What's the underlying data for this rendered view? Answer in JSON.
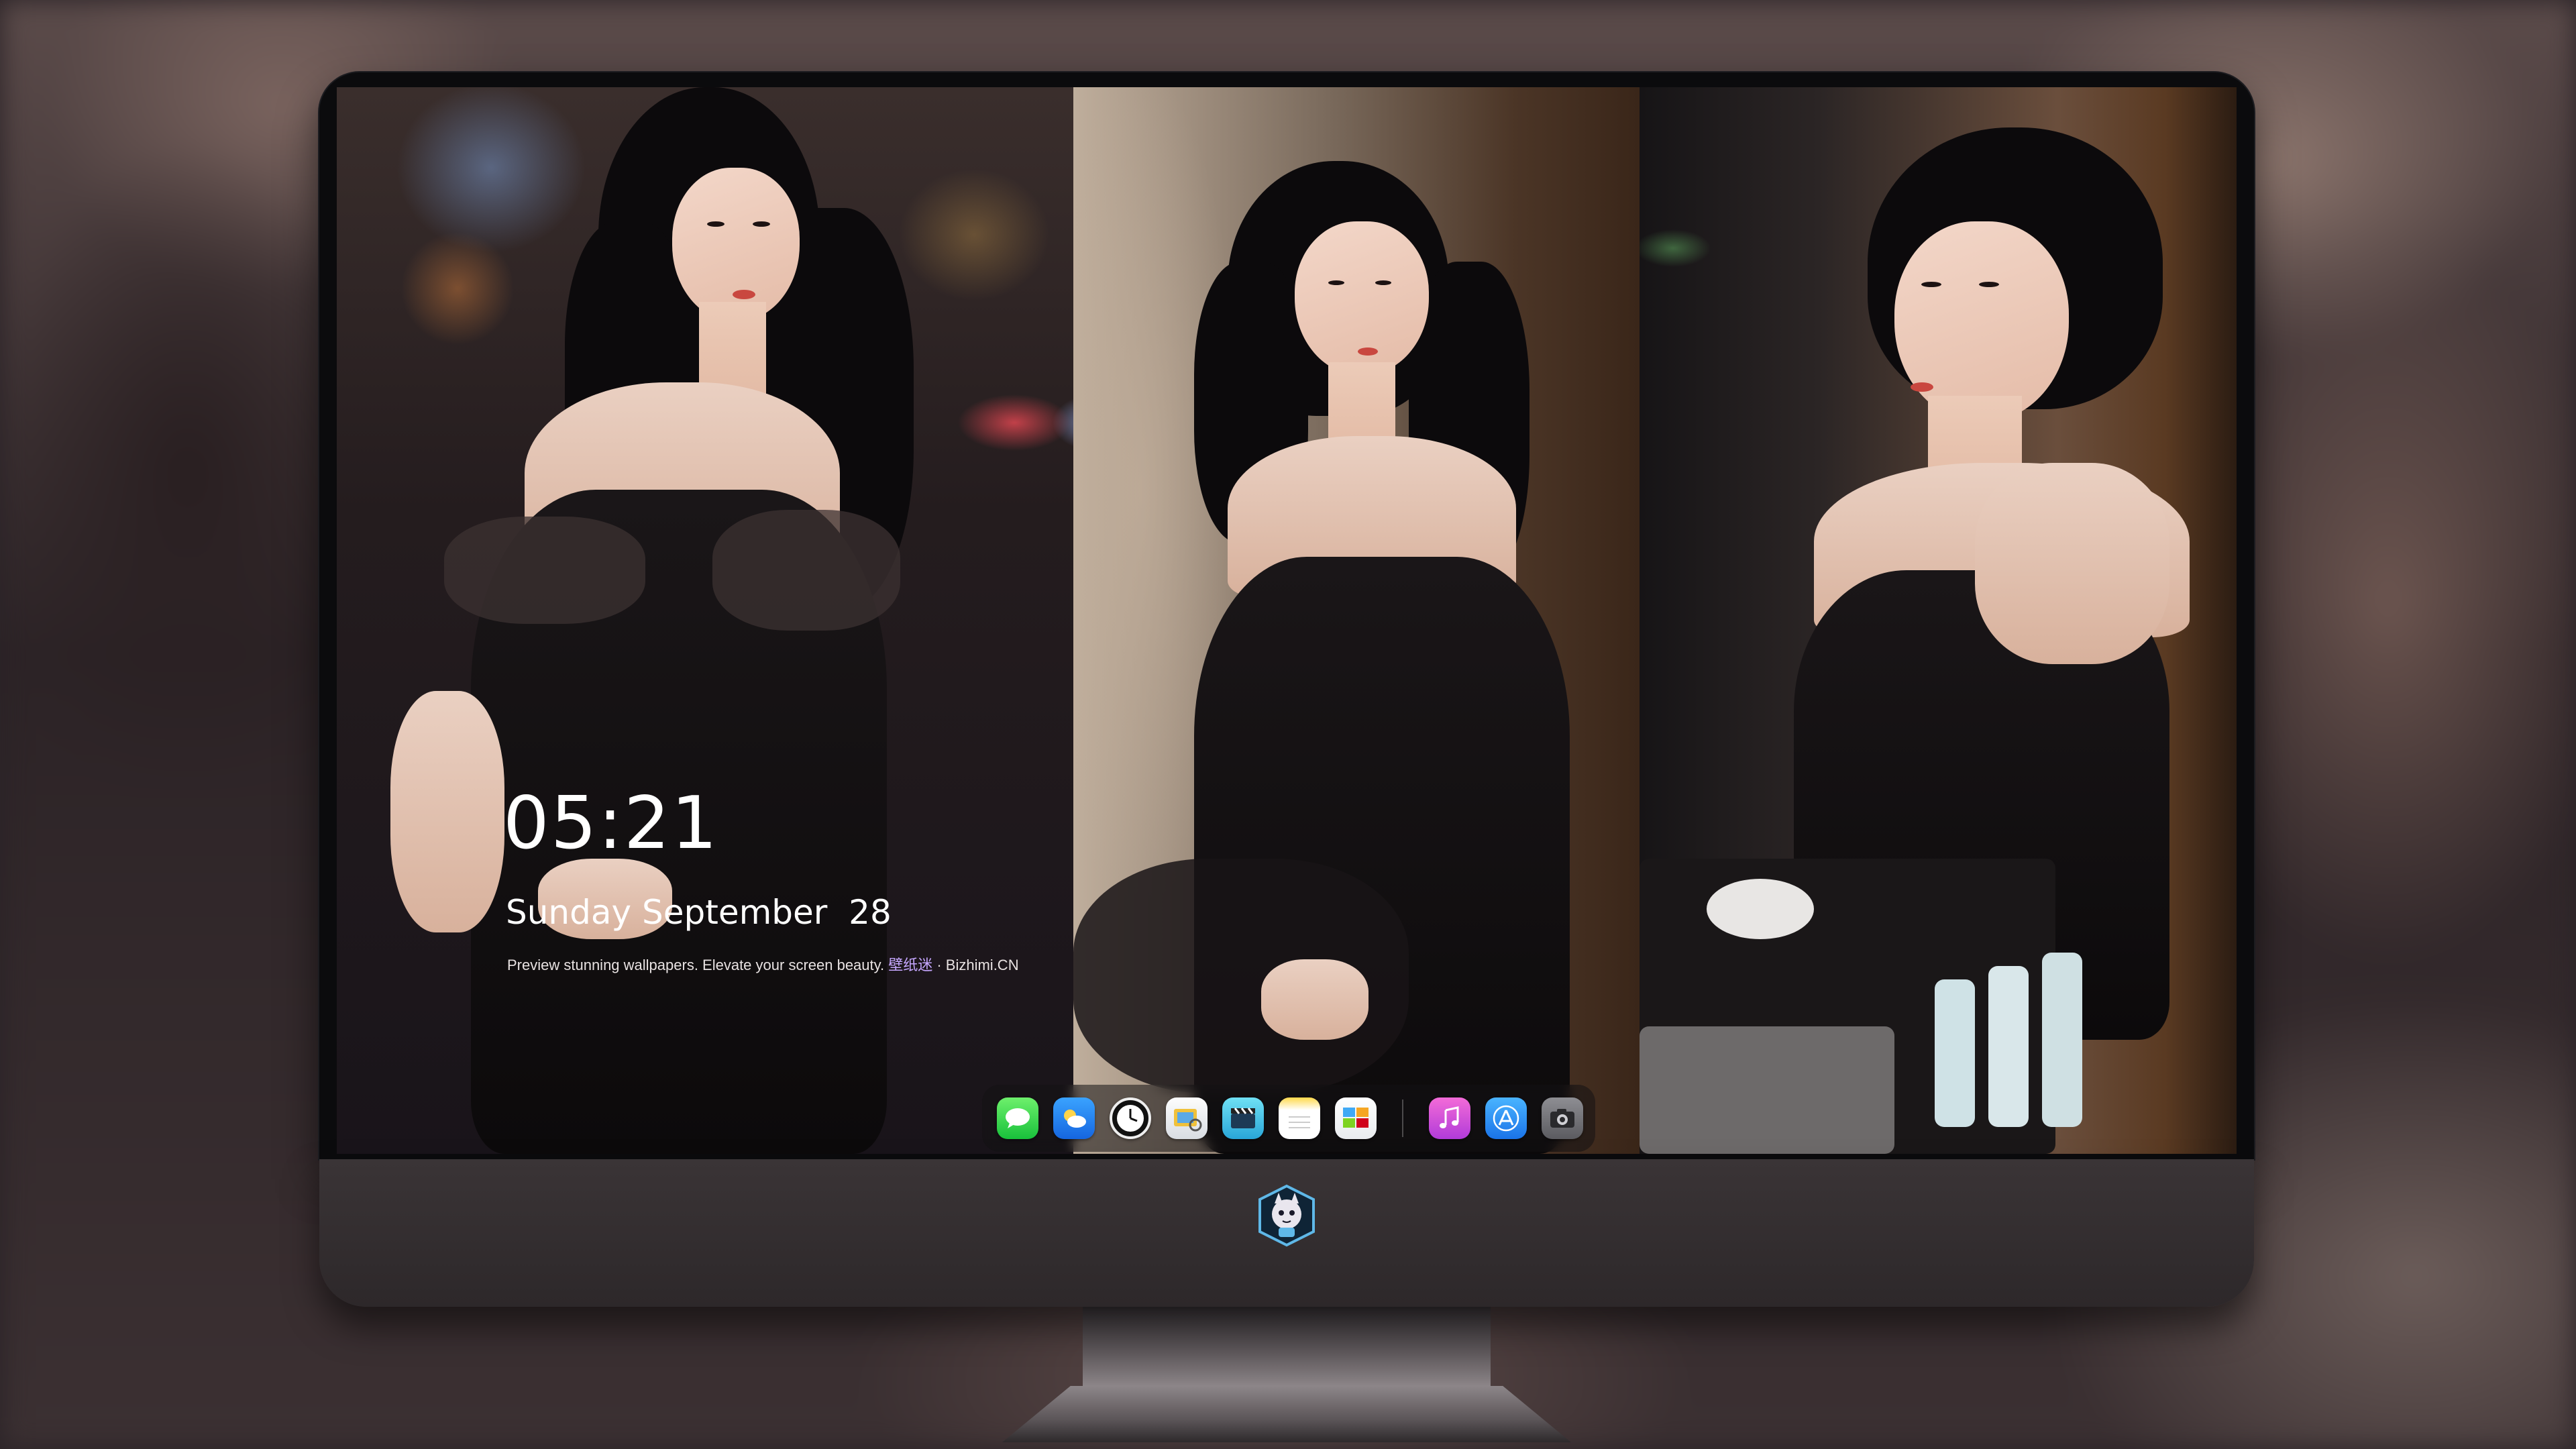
{
  "lock_screen": {
    "time": "05:21",
    "date": "Sunday September  28",
    "tagline_text": "Preview stunning wallpapers. Elevate your screen beauty. ",
    "tagline_brand_cn": "壁纸迷",
    "tagline_brand_en": " · Bizhimi.CN"
  },
  "dock": {
    "apps": [
      {
        "name": "messages-icon"
      },
      {
        "name": "weather-icon"
      },
      {
        "name": "clock-icon"
      },
      {
        "name": "preview-icon"
      },
      {
        "name": "video-icon"
      },
      {
        "name": "notes-icon"
      },
      {
        "name": "photos-icon"
      },
      {
        "name": "music-icon"
      },
      {
        "name": "app-store-icon"
      },
      {
        "name": "camera-icon"
      }
    ]
  },
  "colors": {
    "bezel": "#0b0b0d",
    "chin": "#3a3436",
    "text": "#ffffff",
    "brand_accent": "#c6a7ff"
  }
}
